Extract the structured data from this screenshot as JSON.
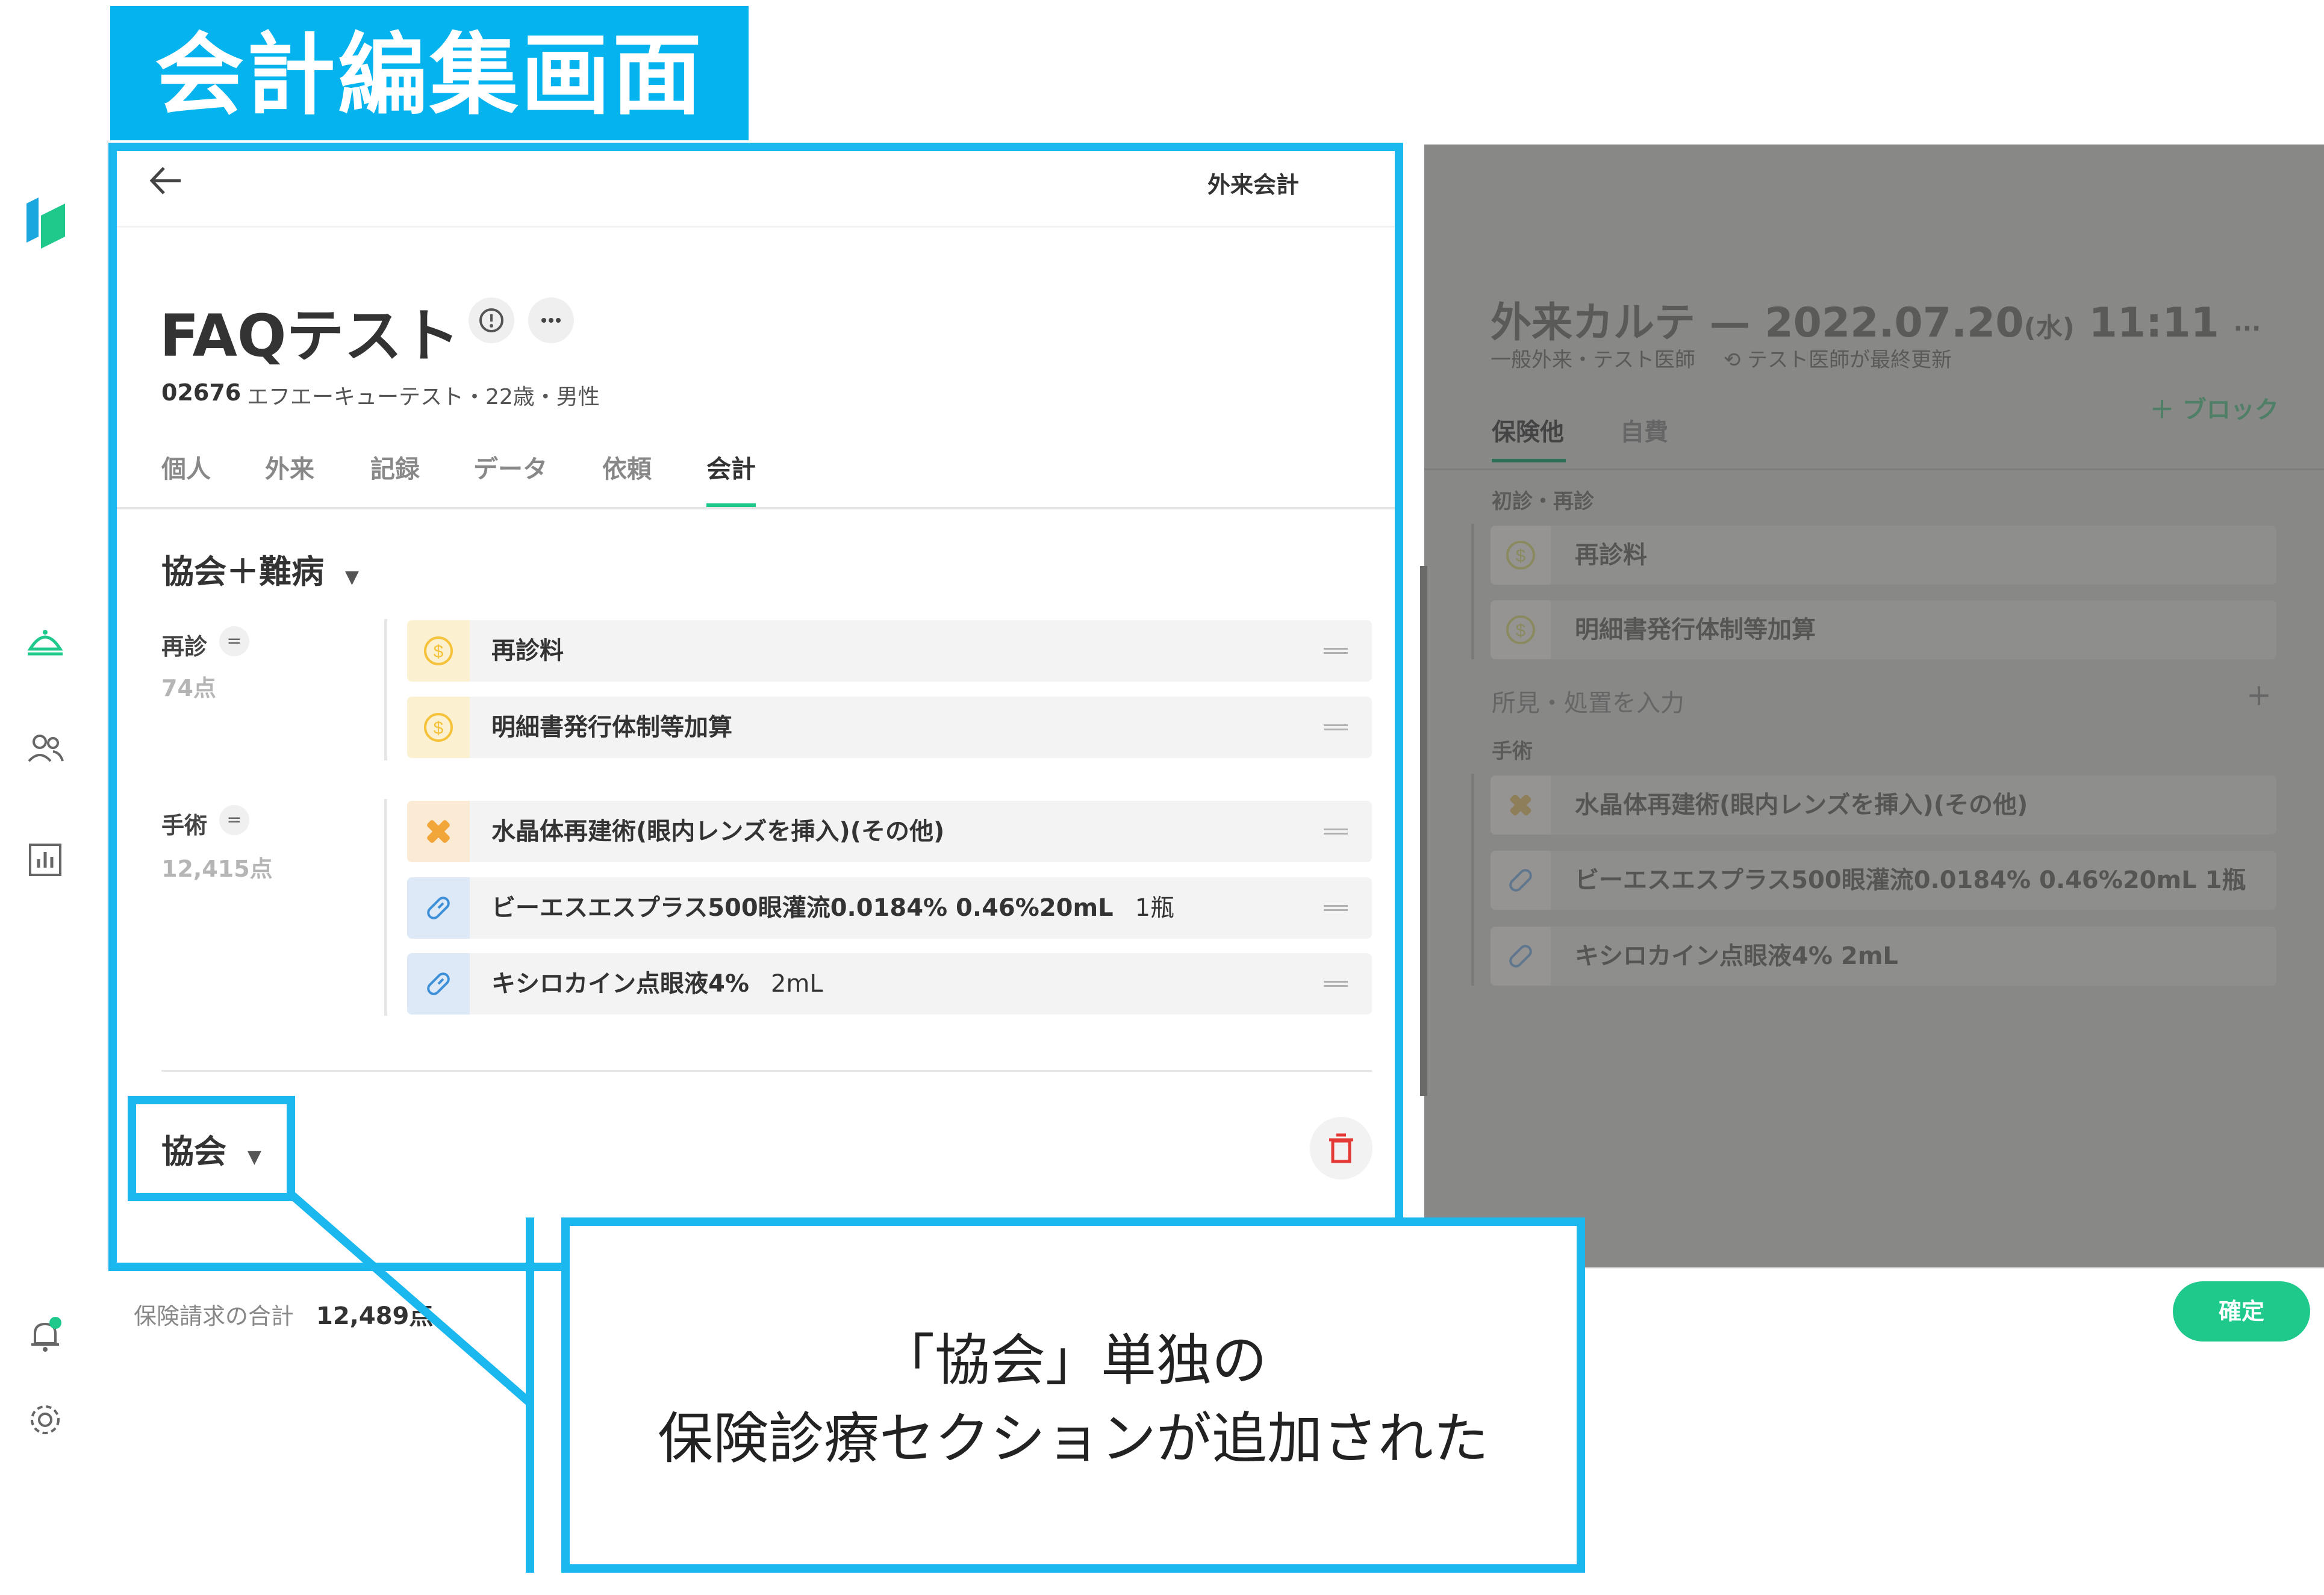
{
  "banner": {
    "title": "会計編集画面"
  },
  "header": {
    "title": "外来会計"
  },
  "patient": {
    "name": "FAQテスト",
    "id": "02676",
    "details": "エフエーキューテスト・22歳・男性"
  },
  "tabs": [
    {
      "label": "個人"
    },
    {
      "label": "外来"
    },
    {
      "label": "記録"
    },
    {
      "label": "データ"
    },
    {
      "label": "依頼"
    },
    {
      "label": "会計",
      "active": true
    }
  ],
  "section1": {
    "insurance": "協会＋難病",
    "groups": [
      {
        "name": "再診",
        "points": "74点",
        "items": [
          {
            "label": "再診料",
            "icon": "coin-icon"
          },
          {
            "label": "明細書発行体制等加算",
            "icon": "coin-icon"
          }
        ]
      },
      {
        "name": "手術",
        "points": "12,415点",
        "items": [
          {
            "label": "水晶体再建術(眼内レンズを挿入)(その他)",
            "icon": "bandage-icon"
          },
          {
            "label": "ビーエスエスプラス500眼灌流0.0184% 0.46%20mL",
            "qty": "1瓶",
            "icon": "pill-icon"
          },
          {
            "label": "キシロカイン点眼液4%",
            "qty": "2mL",
            "icon": "pill-icon"
          }
        ]
      }
    ]
  },
  "section2": {
    "insurance": "協会"
  },
  "footer": {
    "total_label": "保険請求の合計",
    "total_value": "12,489点",
    "confirm": "確定"
  },
  "karte": {
    "title": "外来カルテ — 2022.07.20",
    "weekday": "(水)",
    "time": "11:11",
    "more": "···",
    "meta": "一般外来・テスト医師",
    "updated": "テスト医師が最終更新",
    "add_block": "＋ ブロック",
    "tabs": [
      "保険他",
      "自費"
    ],
    "section_initial": "初診・再診",
    "items_initial": [
      "再診料",
      "明細書発行体制等加算"
    ],
    "findings_placeholder": "所見・処置を入力",
    "section_surgery": "手術",
    "items_surgery": [
      {
        "label": "水晶体再建術(眼内レンズを挿入)(その他)"
      },
      {
        "label": "ビーエスエスプラス500眼灌流0.0184% 0.46%20mL",
        "qty": "1瓶"
      },
      {
        "label": "キシロカイン点眼液4%",
        "qty": "2mL"
      }
    ]
  },
  "callout": {
    "line1": "「協会」単独の",
    "line2": "保険診療セクションが追加された"
  },
  "colors": {
    "accent": "#05b4ef",
    "primary": "#1fc98c",
    "delete": "#e53935",
    "coin": "#f5c23c",
    "bandage": "#f2a63a",
    "pill": "#3d8fd8"
  }
}
